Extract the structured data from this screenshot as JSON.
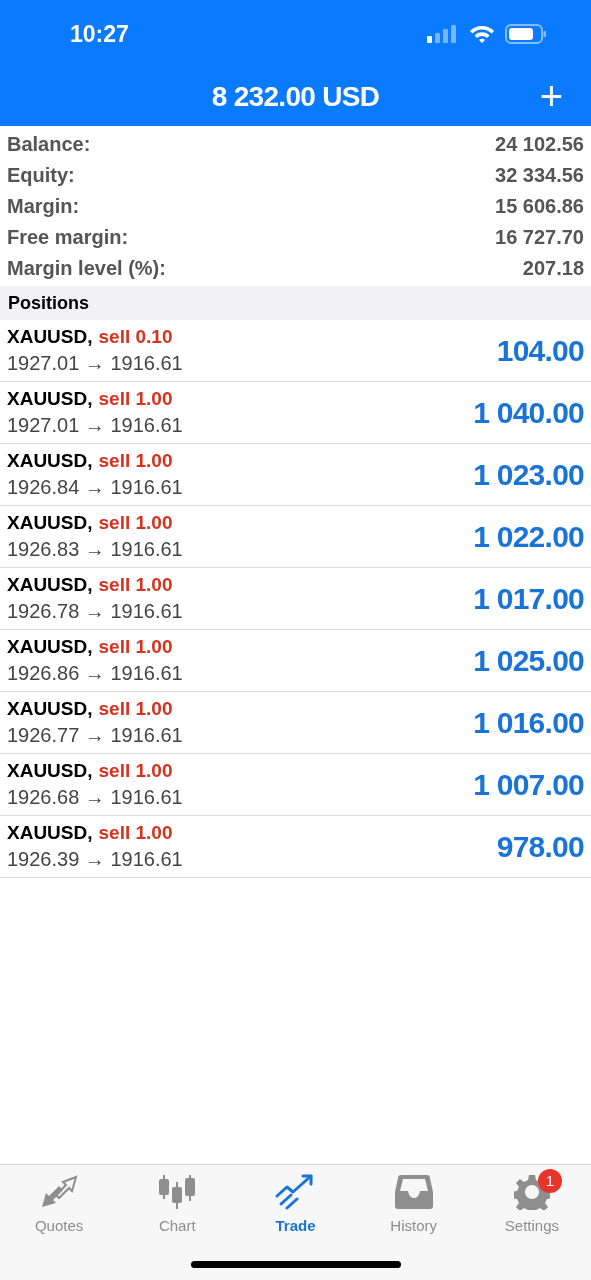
{
  "status_bar": {
    "time": "10:27"
  },
  "header": {
    "title": "8 232.00 USD",
    "add_icon": "+"
  },
  "summary": [
    {
      "label": "Balance:",
      "value": "24 102.56"
    },
    {
      "label": "Equity:",
      "value": "32 334.56"
    },
    {
      "label": "Margin:",
      "value": "15 606.86"
    },
    {
      "label": "Free margin:",
      "value": "16 727.70"
    },
    {
      "label": "Margin level (%):",
      "value": "207.18"
    }
  ],
  "positions": {
    "title": "Positions",
    "rows": [
      {
        "symbol": "XAUUSD,",
        "order": "sell 0.10",
        "prices": "1927.01 → 1916.61",
        "profit": "104.00"
      },
      {
        "symbol": "XAUUSD,",
        "order": "sell 1.00",
        "prices": "1927.01 → 1916.61",
        "profit": "1 040.00"
      },
      {
        "symbol": "XAUUSD,",
        "order": "sell 1.00",
        "prices": "1926.84 → 1916.61",
        "profit": "1 023.00"
      },
      {
        "symbol": "XAUUSD,",
        "order": "sell 1.00",
        "prices": "1926.83 → 1916.61",
        "profit": "1 022.00"
      },
      {
        "symbol": "XAUUSD,",
        "order": "sell 1.00",
        "prices": "1926.78 → 1916.61",
        "profit": "1 017.00"
      },
      {
        "symbol": "XAUUSD,",
        "order": "sell 1.00",
        "prices": "1926.86 → 1916.61",
        "profit": "1 025.00"
      },
      {
        "symbol": "XAUUSD,",
        "order": "sell 1.00",
        "prices": "1926.77 → 1916.61",
        "profit": "1 016.00"
      },
      {
        "symbol": "XAUUSD,",
        "order": "sell 1.00",
        "prices": "1926.68 → 1916.61",
        "profit": "1 007.00"
      },
      {
        "symbol": "XAUUSD,",
        "order": "sell 1.00",
        "prices": "1926.39 → 1916.61",
        "profit": "978.00"
      }
    ]
  },
  "tab_bar": [
    {
      "kind": "quotes",
      "label": "Quotes",
      "selected": false
    },
    {
      "kind": "chart",
      "label": "Chart",
      "selected": false
    },
    {
      "kind": "trade",
      "label": "Trade",
      "selected": true
    },
    {
      "kind": "history",
      "label": "History",
      "selected": false
    },
    {
      "kind": "settings",
      "label": "Settings",
      "selected": false,
      "badge": "1"
    }
  ]
}
